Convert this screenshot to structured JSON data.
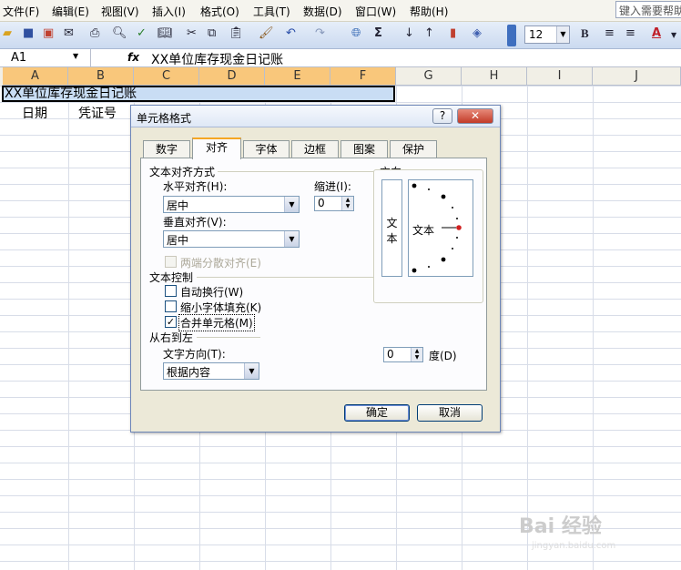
{
  "menu": [
    "文件(F)",
    "编辑(E)",
    "视图(V)",
    "插入(I)",
    "格式(O)",
    "工具(T)",
    "数据(D)",
    "窗口(W)",
    "帮助(H)"
  ],
  "help_search_placeholder": "键入需要帮助",
  "toolbar": {
    "font_size": "12",
    "bold_label": "B"
  },
  "formula_bar": {
    "name_box": "A1",
    "fx": "fx",
    "content": "XX单位库存现金日记账"
  },
  "columns": [
    "A",
    "B",
    "C",
    "D",
    "E",
    "F",
    "G",
    "H",
    "I",
    "J"
  ],
  "cells": {
    "merged_title": "XX单位库存现金日记账",
    "a2": "日期",
    "b2": "凭证号"
  },
  "dialog": {
    "title": "单元格格式",
    "help": "?",
    "close": "✕",
    "tabs": [
      "数字",
      "对齐",
      "字体",
      "边框",
      "图案",
      "保护"
    ],
    "active_tab": "对齐",
    "text_align_group": "文本对齐方式",
    "horizontal_label": "水平对齐(H):",
    "horizontal_value": "居中",
    "indent_label": "缩进(I):",
    "indent_value": "0",
    "vertical_label": "垂直对齐(V):",
    "vertical_value": "居中",
    "distributed_label": "两端分散对齐(E)",
    "text_control_group": "文本控制",
    "wrap_label": "自动换行(W)",
    "shrink_label": "缩小字体填充(K)",
    "merge_label": "合并单元格(M)",
    "rtl_group": "从右到左",
    "direction_label": "文字方向(T):",
    "direction_value": "根据内容",
    "orientation_group": "方向",
    "vertical_text_1": "文",
    "vertical_text_2": "本",
    "orient_text": "文本",
    "degree_value": "0",
    "degree_label": "度(D)",
    "ok": "确定",
    "cancel": "取消",
    "merge_checked": true
  },
  "watermark": "Bai 经验",
  "watermark_url": "jingyan.baidu.com"
}
